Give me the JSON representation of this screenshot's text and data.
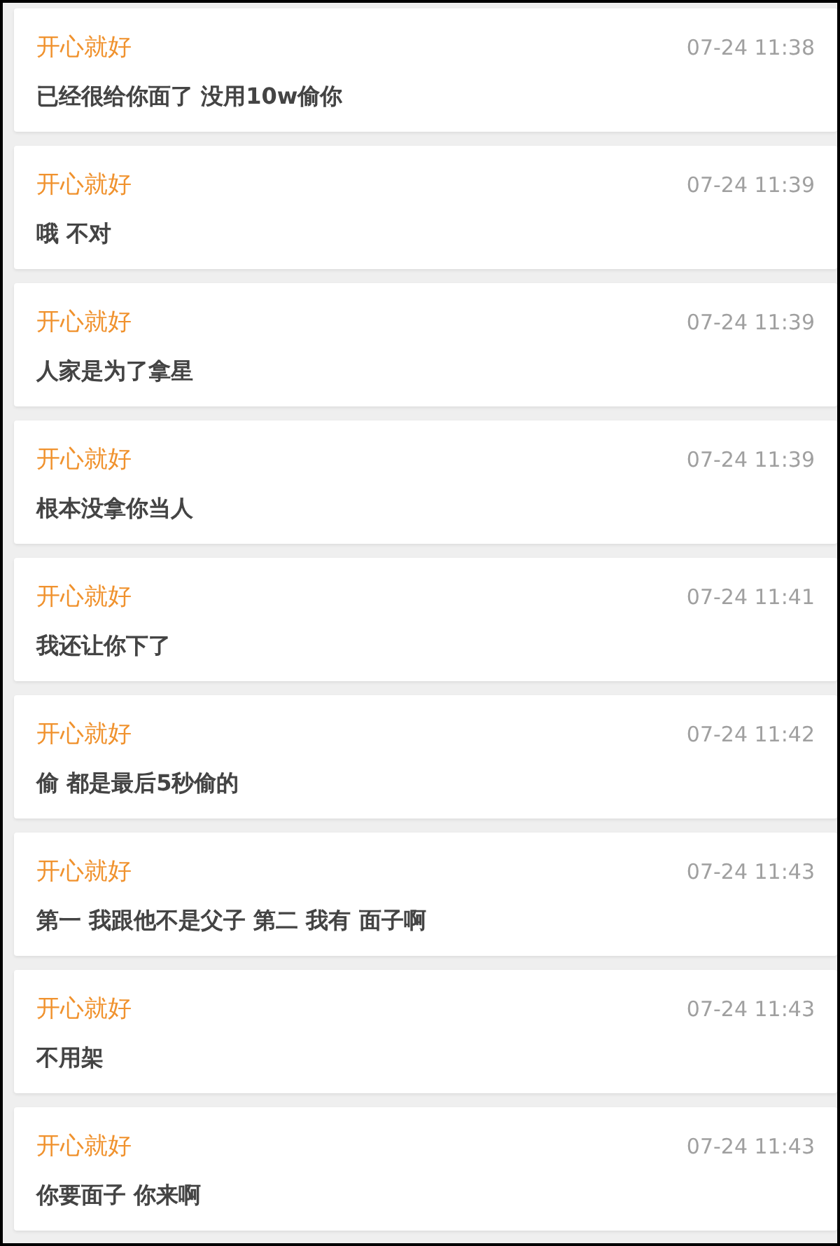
{
  "messages": [
    {
      "sender": "开心就好",
      "time": "07-24 11:38",
      "text": "已经很给你面了 没用10w偷你"
    },
    {
      "sender": "开心就好",
      "time": "07-24 11:39",
      "text": "哦 不对"
    },
    {
      "sender": "开心就好",
      "time": "07-24 11:39",
      "text": "人家是为了拿星"
    },
    {
      "sender": "开心就好",
      "time": "07-24 11:39",
      "text": "根本没拿你当人"
    },
    {
      "sender": "开心就好",
      "time": "07-24 11:41",
      "text": "我还让你下了"
    },
    {
      "sender": "开心就好",
      "time": "07-24 11:42",
      "text": "偷 都是最后5秒偷的"
    },
    {
      "sender": "开心就好",
      "time": "07-24 11:43",
      "text": "第一 我跟他不是父子 第二 我有 面子啊"
    },
    {
      "sender": "开心就好",
      "time": "07-24 11:43",
      "text": "不用架"
    },
    {
      "sender": "开心就好",
      "time": "07-24 11:43",
      "text": "你要面子 你来啊"
    }
  ]
}
